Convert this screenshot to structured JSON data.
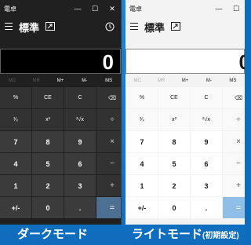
{
  "dark": {
    "app_title": "電卓",
    "mode_title": "標準",
    "display_value": "0",
    "memory": [
      "MC",
      "MR",
      "M+",
      "M-",
      "MS"
    ],
    "keys": [
      "%",
      "CE",
      "C",
      "⌫",
      "¹⁄ₓ",
      "x²",
      "²√x",
      "÷",
      "7",
      "8",
      "9",
      "×",
      "4",
      "5",
      "6",
      "−",
      "1",
      "2",
      "3",
      "+",
      "+/-",
      "0",
      ".",
      "="
    ],
    "caption": "ダークモード"
  },
  "light": {
    "app_title": "電卓",
    "mode_title": "標準",
    "display_value": "0",
    "memory": [
      "MC",
      "MR",
      "M+",
      "M-",
      "MS"
    ],
    "keys": [
      "%",
      "CE",
      "C",
      "⌫",
      "¹⁄ₓ",
      "x²",
      "²√x",
      "÷",
      "7",
      "8",
      "9",
      "×",
      "4",
      "5",
      "6",
      "−",
      "1",
      "2",
      "3",
      "+",
      "+/-",
      "0",
      ".",
      "="
    ],
    "caption": "ライトモード",
    "caption_suffix": "(初期設定)"
  },
  "window_controls": [
    "—",
    "☐",
    "✕"
  ],
  "colors": {
    "background_blue": "#0f6cbd",
    "dark_bg": "#202020",
    "light_bg": "#f3f3f3",
    "dark_equals": "#4c6f92",
    "light_equals": "#8fbfe6"
  }
}
